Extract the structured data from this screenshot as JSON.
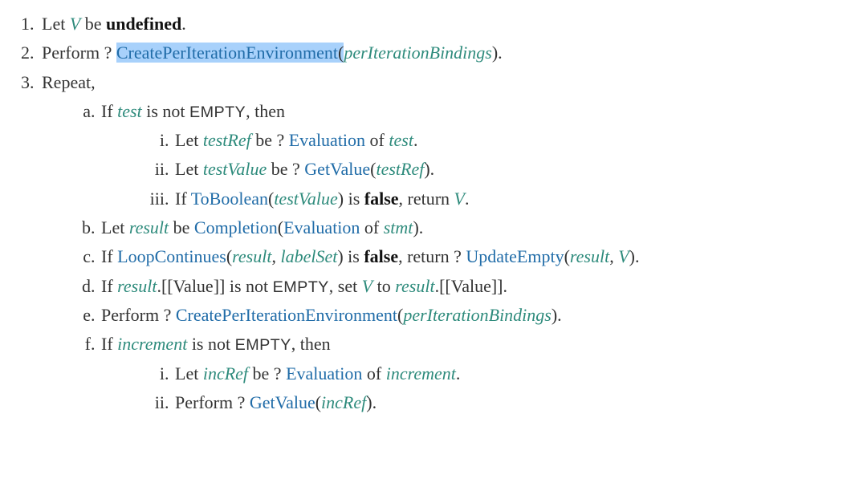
{
  "s1": {
    "t1a": "Let ",
    "v1": "V",
    "t1b": " be ",
    "bold": "undefined",
    "dot": "."
  },
  "s2": {
    "t1": "Perform ? ",
    "op": "CreatePerIterationEnvironment",
    "lp": "(",
    "arg": "perIterationBindings",
    "rp": ")."
  },
  "s3": {
    "t1": "Repeat,",
    "a": {
      "t1": "If ",
      "var1": "test",
      "t2": " is not ",
      "empty": "EMPTY",
      "t3": ", then",
      "i": {
        "t1": "Let ",
        "var1": "testRef",
        "t2": " be ? ",
        "op": "Evaluation",
        "t3": " of ",
        "var2": "test",
        "dot": "."
      },
      "ii": {
        "t1": "Let ",
        "var1": "testValue",
        "t2": " be ? ",
        "op": "GetValue",
        "lp": "(",
        "arg": "testRef",
        "rp": ")."
      },
      "iii": {
        "t1": "If ",
        "op": "ToBoolean",
        "lp": "(",
        "arg": "testValue",
        "rp": ") is ",
        "bold": "false",
        "t2": ", return ",
        "var1": "V",
        "dot": "."
      }
    },
    "b": {
      "t1": "Let ",
      "var1": "result",
      "t2": " be ",
      "op1": "Completion",
      "lp": "(",
      "op2": "Evaluation",
      "t3": " of ",
      "var2": "stmt",
      "rp": ")."
    },
    "c": {
      "t1": "If ",
      "op1": "LoopContinues",
      "lp": "(",
      "arg1": "result",
      "comma": ", ",
      "arg2": "labelSet",
      "rp": ") is ",
      "bold": "false",
      "t2": ", return ? ",
      "op2": "UpdateEmpty",
      "lp2": "(",
      "arg3": "result",
      "comma2": ", ",
      "arg4": "V",
      "rp2": ")."
    },
    "d": {
      "t1": "If ",
      "var1": "result",
      "t2": ".[[Value]] is not ",
      "empty": "EMPTY",
      "t3": ", set ",
      "var2": "V",
      "t4": " to ",
      "var3": "result",
      "t5": ".[[Value]]."
    },
    "e": {
      "t1": "Perform ? ",
      "op": "CreatePerIterationEnvironment",
      "lp": "(",
      "arg": "perIterationBindings",
      "rp": ")."
    },
    "f": {
      "t1": "If ",
      "var1": "increment",
      "t2": " is not ",
      "empty": "EMPTY",
      "t3": ", then",
      "i": {
        "t1": "Let ",
        "var1": "incRef",
        "t2": " be ? ",
        "op": "Evaluation",
        "t3": " of ",
        "var2": "increment",
        "dot": "."
      },
      "ii": {
        "t1": "Perform ? ",
        "op": "GetValue",
        "lp": "(",
        "arg": "incRef",
        "rp": ")."
      }
    }
  }
}
